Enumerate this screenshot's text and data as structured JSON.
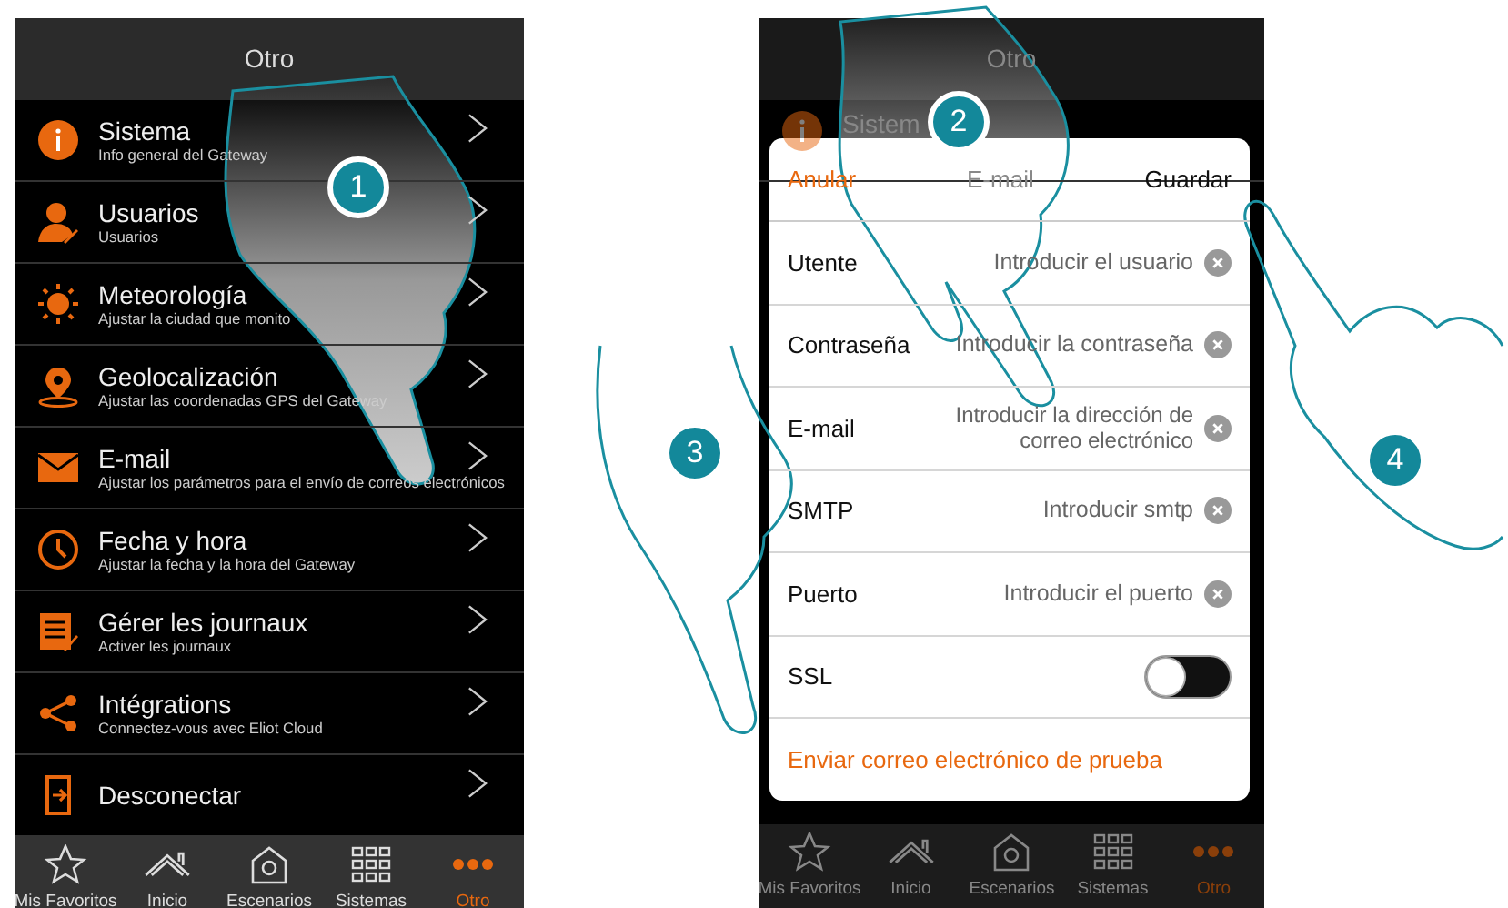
{
  "screens": [
    {
      "title": "Otro",
      "menu": [
        {
          "title": "Sistema",
          "subtitle": "Info general del Gateway"
        },
        {
          "title": "Usuarios",
          "subtitle": "Usuarios"
        },
        {
          "title": "Meteorología",
          "subtitle": "Ajustar la ciudad que monito"
        },
        {
          "title": "Geolocalización",
          "subtitle": "Ajustar las coordenadas GPS del Gateway"
        },
        {
          "title": "E-mail",
          "subtitle": "Ajustar los parámetros para el envío de correos electrónicos"
        },
        {
          "title": "Fecha y hora",
          "subtitle": "Ajustar la fecha y la hora del Gateway"
        },
        {
          "title": "Gérer les journaux",
          "subtitle": "Activer les journaux"
        },
        {
          "title": "Intégrations",
          "subtitle": "Connectez-vous avec Eliot Cloud"
        },
        {
          "title": "Desconectar"
        }
      ],
      "tabs": [
        {
          "label": "Mis Favoritos",
          "selected": false
        },
        {
          "label": "Inicio",
          "selected": false
        },
        {
          "label": "Escenarios",
          "selected": false
        },
        {
          "label": "Sistemas",
          "selected": false
        },
        {
          "label": "Otro",
          "selected": true
        }
      ]
    },
    {
      "title": "Otro",
      "menu": [
        {
          "title": "Sistem"
        }
      ],
      "dialog": {
        "cancel": "Anular",
        "title": "E-mail",
        "save": "Guardar",
        "rows": [
          {
            "kind": "field",
            "label": "Utente",
            "placeholder": "Introducir el usuario"
          },
          {
            "kind": "field",
            "label": "Contraseña",
            "placeholder": "Introducir la contraseña"
          },
          {
            "kind": "field",
            "label": "E-mail",
            "placeholder": "Introducir la dirección de correo electrónico"
          },
          {
            "kind": "field",
            "label": "SMTP",
            "placeholder": "Introducir smtp"
          },
          {
            "kind": "field",
            "label": "Puerto",
            "placeholder": "Introducir el puerto"
          },
          {
            "kind": "toggle",
            "label": "SSL",
            "on": false
          }
        ],
        "test_link": "Enviar correo electrónico de prueba"
      },
      "tabs": [
        {
          "label": "Mis Favoritos",
          "selected": false
        },
        {
          "label": "Inicio",
          "selected": false
        },
        {
          "label": "Escenarios",
          "selected": false
        },
        {
          "label": "Sistemas",
          "selected": false
        },
        {
          "label": "Otro",
          "selected": true
        }
      ]
    }
  ],
  "steps": [
    "1",
    "2",
    "3",
    "4"
  ]
}
